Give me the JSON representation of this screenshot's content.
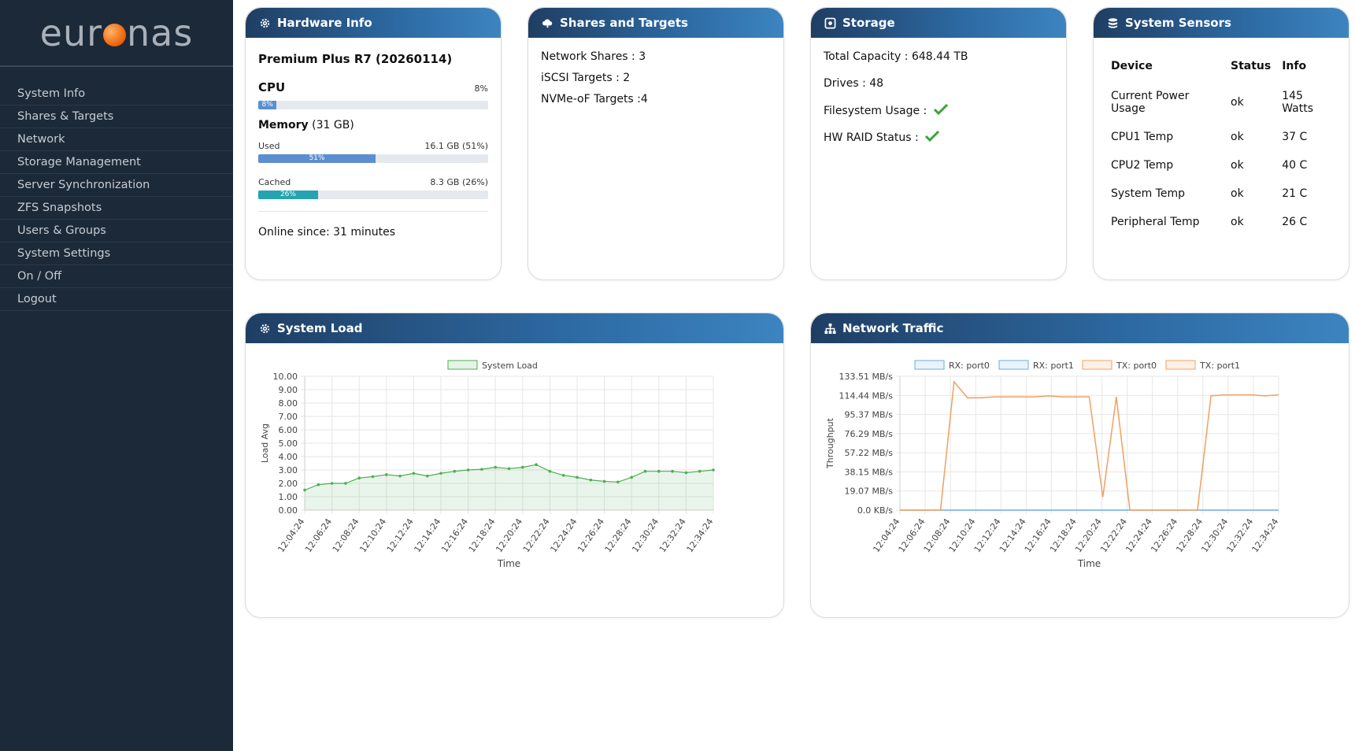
{
  "brand": {
    "pre": "eur",
    "post": "nas"
  },
  "nav": [
    {
      "label": "System Info"
    },
    {
      "label": "Shares & Targets"
    },
    {
      "label": "Network"
    },
    {
      "label": "Storage Management"
    },
    {
      "label": "Server Synchronization"
    },
    {
      "label": "ZFS Snapshots"
    },
    {
      "label": "Users & Groups"
    },
    {
      "label": "System Settings"
    },
    {
      "label": "On / Off"
    },
    {
      "label": "Logout"
    }
  ],
  "hardware": {
    "title": "Hardware Info",
    "model": "Premium Plus R7 (20260114)",
    "cpu_label": "CPU",
    "cpu_percent": "8%",
    "cpu_bar_label": "8%",
    "cpu_value": 8,
    "memory_label": "Memory",
    "memory_total": "(31 GB)",
    "used_label": "Used",
    "used_value": "16.1 GB (51%)",
    "used_bar_label": "51%",
    "used_percent": 51,
    "cached_label": "Cached",
    "cached_value": "8.3 GB (26%)",
    "cached_bar_label": "26%",
    "cached_percent": 26,
    "online": "Online since: 31 minutes"
  },
  "shares": {
    "title": "Shares and Targets",
    "lines": [
      "Network Shares : 3",
      "iSCSI Targets : 2",
      "NVMe-oF Targets :4"
    ]
  },
  "storage": {
    "title": "Storage",
    "capacity": "Total Capacity : 648.44 TB",
    "drives": "Drives : 48",
    "fs_usage": "Filesystem Usage :",
    "raid": "HW RAID Status :"
  },
  "sensors": {
    "title": "System Sensors",
    "headers": [
      "Device",
      "Status",
      "Info"
    ],
    "rows": [
      [
        "Current Power Usage",
        "ok",
        "145 Watts"
      ],
      [
        "CPU1 Temp",
        "ok",
        "37 C"
      ],
      [
        "CPU2 Temp",
        "ok",
        "40 C"
      ],
      [
        "System Temp",
        "ok",
        "21 C"
      ],
      [
        "Peripheral Temp",
        "ok",
        "26 C"
      ]
    ]
  },
  "colors": {
    "accent": "#2d6aa3",
    "cpu_bar": "#5b8fd0",
    "cached_bar": "#26a3b0",
    "load_line": "#4caf50",
    "tx": "#f0a060",
    "rx": "#6aaee0"
  },
  "chart_data": [
    {
      "type": "area",
      "title": "System Load",
      "legend": [
        "System Load"
      ],
      "xlabel": "Time",
      "ylabel": "Load Avg",
      "ylim": [
        0,
        10
      ],
      "yticks": [
        "10.00",
        "9.00",
        "8.00",
        "7.00",
        "6.00",
        "5.00",
        "4.00",
        "3.00",
        "2.00",
        "1.00",
        "0.00"
      ],
      "xticks": [
        "12:04:24",
        "12:06:24",
        "12:08:24",
        "12:10:24",
        "12:12:24",
        "12:14:24",
        "12:16:24",
        "12:18:24",
        "12:20:24",
        "12:22:24",
        "12:24:24",
        "12:26:24",
        "12:28:24",
        "12:30:24",
        "12:32:24",
        "12:34:24"
      ],
      "series": [
        {
          "name": "System Load",
          "values": [
            1.5,
            1.9,
            2.0,
            2.0,
            2.4,
            2.5,
            2.65,
            2.55,
            2.75,
            2.55,
            2.75,
            2.9,
            3.0,
            3.05,
            3.2,
            3.1,
            3.2,
            3.4,
            2.9,
            2.6,
            2.45,
            2.25,
            2.15,
            2.1,
            2.45,
            2.9,
            2.9,
            2.9,
            2.8,
            2.9,
            3.0
          ]
        }
      ]
    },
    {
      "type": "line",
      "title": "Network Traffic",
      "legend": [
        "RX: port0",
        "RX: port1",
        "TX: port0",
        "TX: port1"
      ],
      "xlabel": "Time",
      "ylabel": "Throughput",
      "ylim": [
        0,
        133.51
      ],
      "yticks": [
        "133.51 MB/s",
        "114.44 MB/s",
        "95.37 MB/s",
        "76.29 MB/s",
        "57.22 MB/s",
        "38.15 MB/s",
        "19.07 MB/s",
        "0.0 KB/s"
      ],
      "xticks": [
        "12:04:24",
        "12:06:24",
        "12:08:24",
        "12:10:24",
        "12:12:24",
        "12:14:24",
        "12:16:24",
        "12:18:24",
        "12:20:24",
        "12:22:24",
        "12:24:24",
        "12:26:24",
        "12:28:24",
        "12:30:24",
        "12:32:24",
        "12:34:24"
      ],
      "series": [
        {
          "name": "TX: port0",
          "values": [
            0,
            0,
            0,
            0,
            128,
            112,
            112,
            113,
            113,
            113,
            113,
            114,
            113,
            113,
            113,
            13,
            113,
            0,
            0,
            0,
            0,
            0,
            0,
            114,
            115,
            115,
            115,
            114,
            115
          ]
        },
        {
          "name": "RX: port0",
          "values": [
            0,
            0,
            0,
            0,
            0,
            0,
            0,
            0,
            0,
            0,
            0,
            0,
            0,
            0,
            0,
            0,
            0,
            0,
            0,
            0,
            0,
            0,
            0,
            0,
            0,
            0,
            0,
            0,
            0
          ]
        }
      ]
    }
  ]
}
